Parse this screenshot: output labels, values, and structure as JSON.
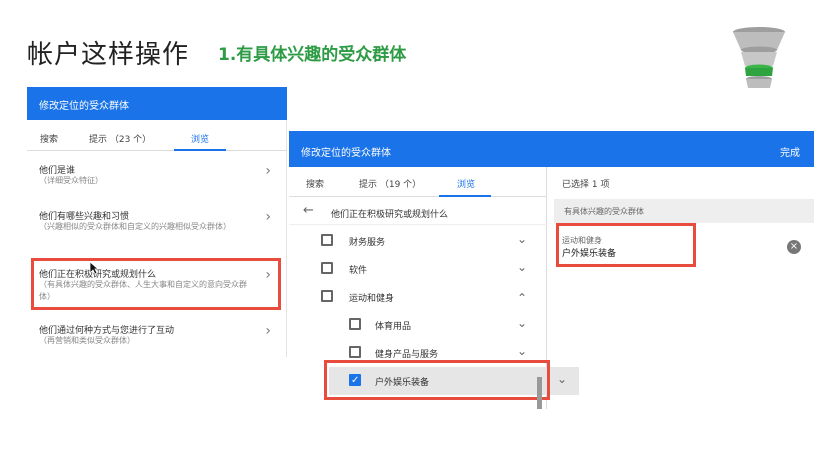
{
  "slide": {
    "title": "帐户这样操作",
    "subtitle": "1.有具体兴趣的受众群体"
  },
  "panel1": {
    "header": "修改定位的受众群体",
    "tabs": [
      "搜索",
      "提示 （23 个）",
      "浏览"
    ],
    "items": [
      {
        "title": "他们是谁",
        "subtitle": "（详细受众特征）"
      },
      {
        "title": "他们有哪些兴趣和习惯",
        "subtitle": "（兴趣相似的受众群体和自定义的兴趣相似受众群体）"
      },
      {
        "title": "他们正在积极研究或规划什么",
        "subtitle": "（有具体兴趣的受众群体、人生大事和自定义的意向受众群体）"
      },
      {
        "title": "他们通过何种方式与您进行了互动",
        "subtitle": "（再营销和类似受众群体）"
      }
    ]
  },
  "panel2": {
    "header": "修改定位的受众群体",
    "done": "完成",
    "tabs": [
      "搜索",
      "提示 （19 个）",
      "浏览"
    ],
    "back_title": "他们正在积极研究或规划什么",
    "rows": [
      {
        "label": "财务服务",
        "checked": false
      },
      {
        "label": "软件",
        "checked": false
      },
      {
        "label": "运动和健身",
        "checked": false
      },
      {
        "label": "体育用品",
        "checked": false
      },
      {
        "label": "健身产品与服务",
        "checked": false
      },
      {
        "label": "户外娱乐装备",
        "checked": true
      }
    ],
    "selected_count": "已选择 1 项",
    "selected_group": "有具体兴趣的受众群体",
    "selected_item_line1": "运动和健身",
    "selected_item_line2": "户外娱乐装备"
  }
}
